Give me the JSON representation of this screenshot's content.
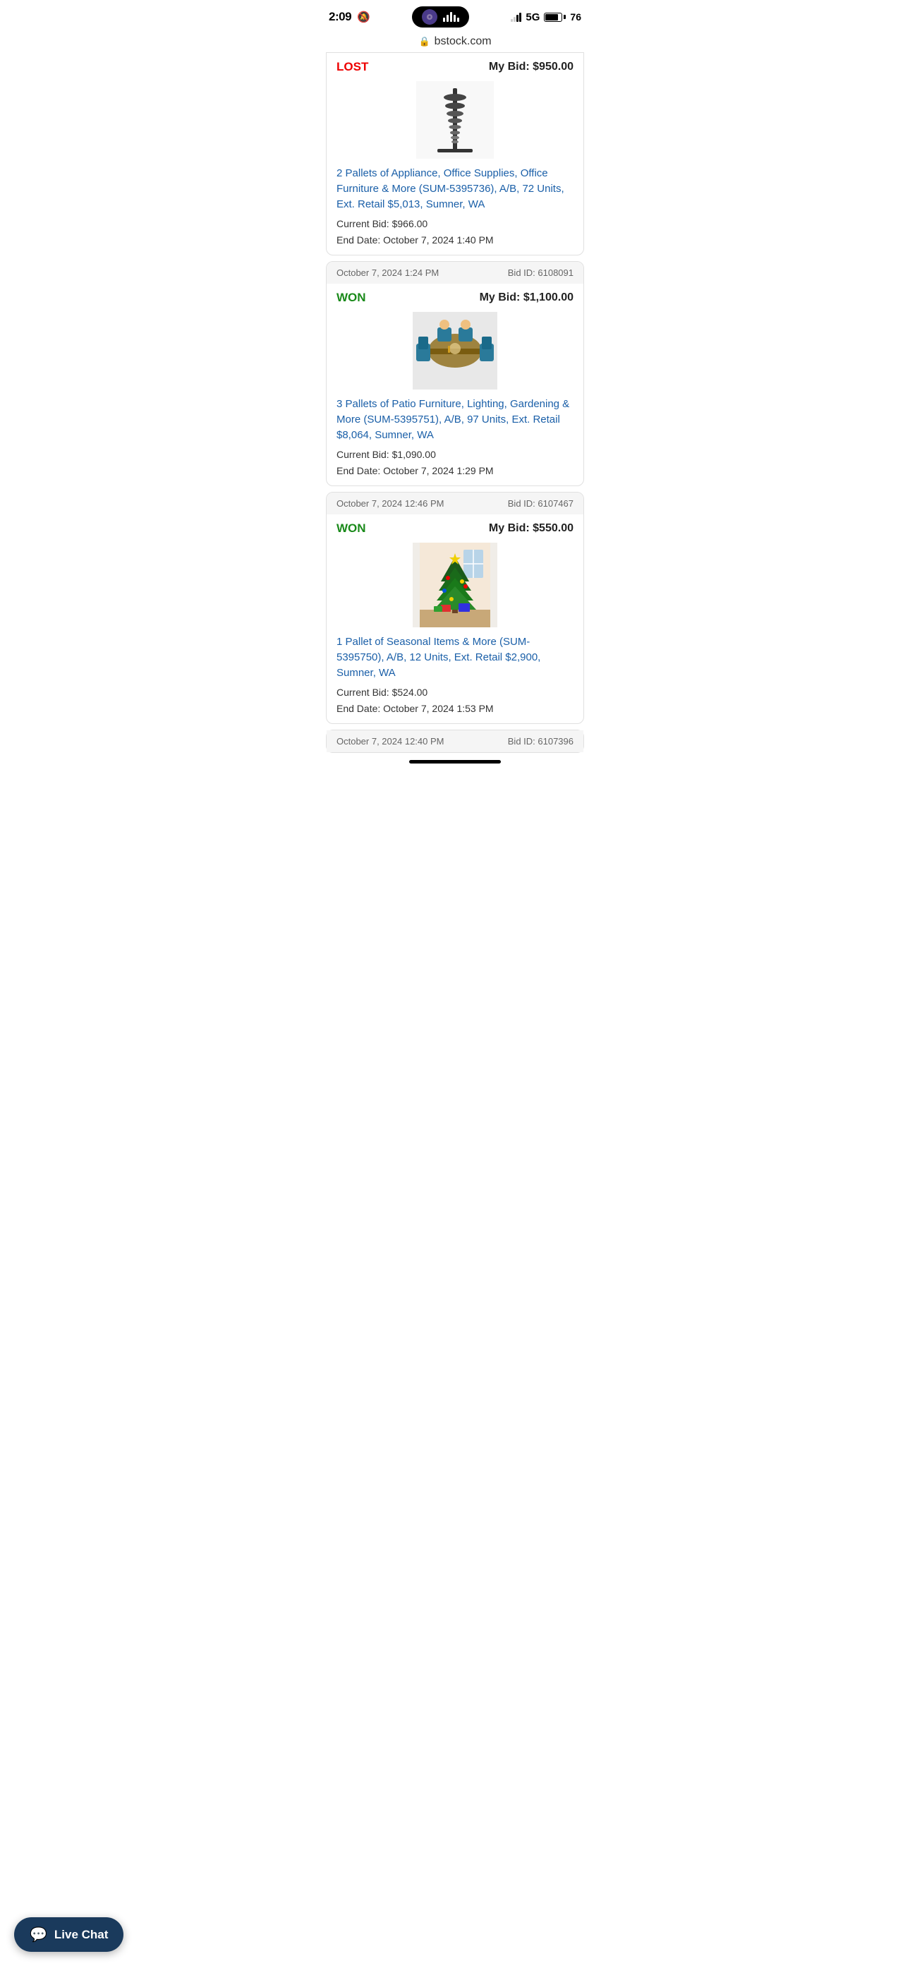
{
  "statusBar": {
    "time": "2:09",
    "bellMuted": true,
    "network": "5G",
    "batteryPercent": "76",
    "signalBars": [
      1,
      1,
      0,
      0
    ]
  },
  "browser": {
    "url": "bstock.com",
    "lockIcon": "🔒"
  },
  "cards": [
    {
      "id": "card-top-partial",
      "status": "LOST",
      "statusType": "lost",
      "myBidLabel": "My Bid:",
      "myBidAmount": "$950.00",
      "productTitle": "2 Pallets of Appliance, Office Supplies, Office Furniture & More (SUM-5395736), A/B, 72 Units, Ext. Retail $5,013, Sumner, WA",
      "currentBid": "Current Bid: $966.00",
      "endDate": "End Date: October 7, 2024 1:40 PM",
      "imageType": "dumbbell-rack"
    },
    {
      "id": "card-won-1",
      "date": "October 7, 2024 1:24 PM",
      "bidId": "Bid ID: 6108091",
      "status": "WON",
      "statusType": "won",
      "myBidLabel": "My Bid:",
      "myBidAmount": "$1,100.00",
      "productTitle": "3 Pallets of Patio Furniture, Lighting, Gardening & More (SUM-5395751), A/B, 97 Units, Ext. Retail $8,064, Sumner, WA",
      "currentBid": "Current Bid: $1,090.00",
      "endDate": "End Date: October 7, 2024 1:29 PM",
      "imageType": "dining-set"
    },
    {
      "id": "card-won-2",
      "date": "October 7, 2024 12:46 PM",
      "bidId": "Bid ID: 6107467",
      "status": "WON",
      "statusType": "won",
      "myBidLabel": "My Bid:",
      "myBidAmount": "$550.00",
      "productTitle": "1 Pallet of Seasonal Items & More (SUM-5395750), A/B, 12 Units, Ext. Retail $2,900, Sumner, WA",
      "currentBid": "Current Bid: $524.00",
      "endDate": "End Date: October 7, 2024 1:53 PM",
      "imageType": "christmas-tree"
    }
  ],
  "bottomPartialCard": {
    "date": "October 7, 2024 12:40 PM",
    "bidId": "Bid ID: 6107396"
  },
  "liveChat": {
    "label": "Live Chat",
    "icon": "💬"
  }
}
